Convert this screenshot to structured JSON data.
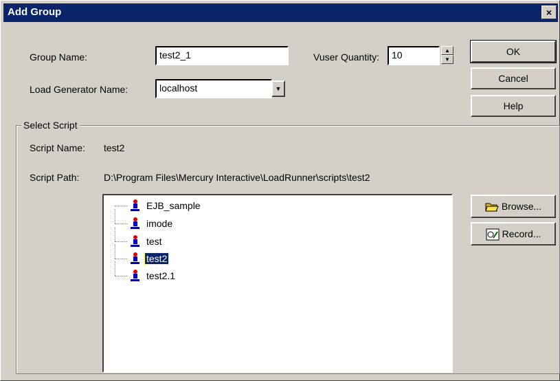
{
  "window": {
    "title": "Add Group",
    "close": "×"
  },
  "form": {
    "group_name_label": "Group Name:",
    "group_name_value": "test2_1",
    "vuser_quantity_label": "Vuser Quantity:",
    "vuser_quantity_value": "10",
    "load_generator_label": "Load Generator Name:",
    "load_generator_value": "localhost"
  },
  "buttons": {
    "ok": "OK",
    "cancel": "Cancel",
    "help": "Help",
    "browse": "Browse...",
    "record": "Record..."
  },
  "select_script": {
    "group_title": "Select Script",
    "script_name_label": "Script Name:",
    "script_name_value": "test2",
    "script_path_label": "Script Path:",
    "script_path_value": "D:\\Program Files\\Mercury Interactive\\LoadRunner\\scripts\\test2",
    "scripts": [
      "EJB_sample",
      "imode",
      "test",
      "test2",
      "test2.1"
    ],
    "selected": "test2"
  },
  "colors": {
    "titlebar": "#0a246a",
    "face": "#d4d0c8",
    "selection": "#0a246a"
  }
}
